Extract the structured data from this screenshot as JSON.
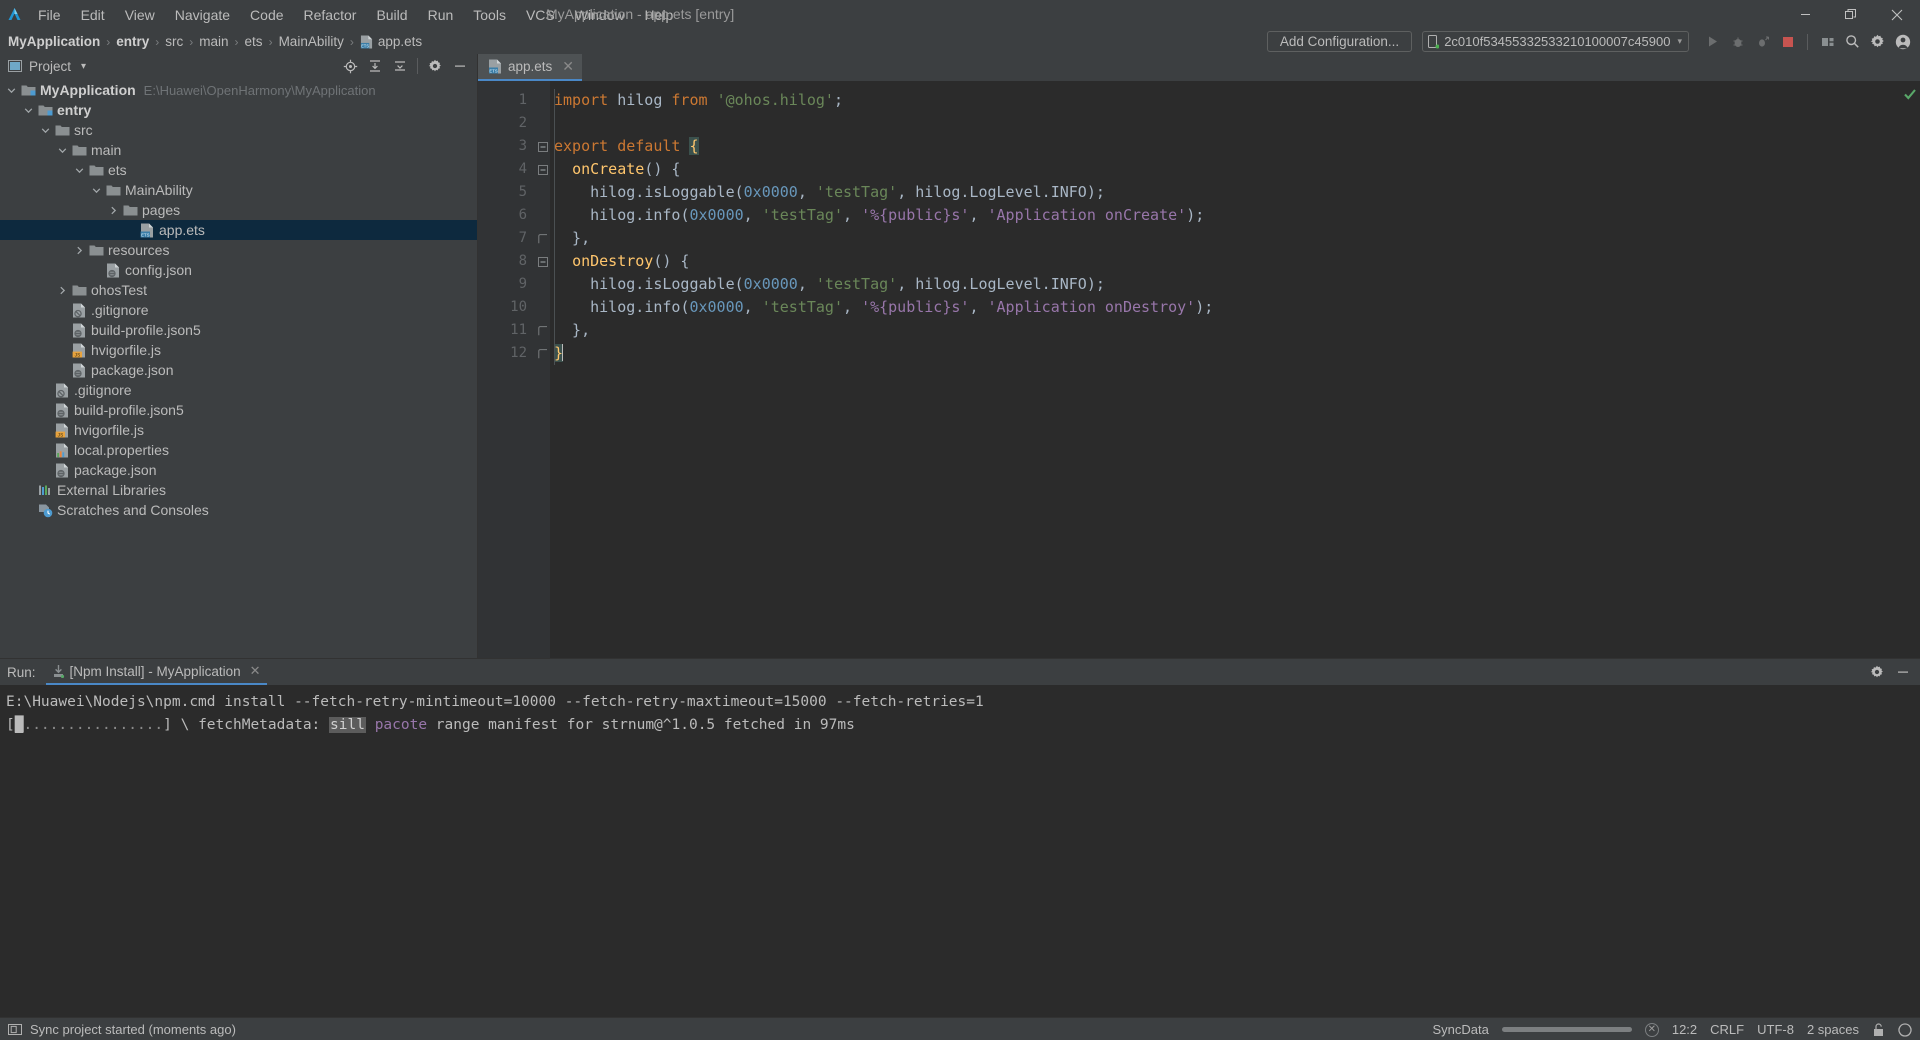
{
  "window": {
    "title": "MyApplication - app.ets [entry]",
    "minimize_label": "Minimize",
    "maximize_label": "Restore",
    "close_label": "Close"
  },
  "menubar": {
    "items": [
      {
        "label": "File"
      },
      {
        "label": "Edit"
      },
      {
        "label": "View"
      },
      {
        "label": "Navigate"
      },
      {
        "label": "Code"
      },
      {
        "label": "Refactor"
      },
      {
        "label": "Build"
      },
      {
        "label": "Run"
      },
      {
        "label": "Tools"
      },
      {
        "label": "VCS"
      },
      {
        "label": "Window"
      },
      {
        "label": "Help"
      }
    ]
  },
  "breadcrumb": {
    "items": [
      "MyApplication",
      "entry",
      "src",
      "main",
      "ets",
      "MainAbility",
      "app.ets"
    ],
    "separator": "›"
  },
  "toolbar": {
    "add_configuration_label": "Add Configuration...",
    "device_label": "2c010f53455332533210100007c45900",
    "device_caret": "▾",
    "icons": [
      {
        "name": "run-icon",
        "title": "Run"
      },
      {
        "name": "debug-icon",
        "title": "Debug"
      },
      {
        "name": "profile-icon",
        "title": "Profile"
      },
      {
        "name": "stop-icon",
        "title": "Stop"
      },
      {
        "name": "project-structure-icon",
        "title": "Project Structure"
      },
      {
        "name": "search-icon",
        "title": "Search Everywhere"
      },
      {
        "name": "settings-icon",
        "title": "Settings"
      },
      {
        "name": "account-icon",
        "title": "Account"
      }
    ]
  },
  "project_panel": {
    "title": "Project",
    "dropdown_caret": "▾",
    "header_icons": [
      {
        "name": "locate-icon",
        "title": "Select Opened File"
      },
      {
        "name": "expand-all-icon",
        "title": "Expand All"
      },
      {
        "name": "collapse-all-icon",
        "title": "Collapse All"
      },
      {
        "name": "gear-icon",
        "title": "Options"
      },
      {
        "name": "hide-icon",
        "title": "Hide"
      }
    ],
    "tree": [
      {
        "label": "MyApplication",
        "path": "E:\\Huawei\\OpenHarmony\\MyApplication",
        "indent": 0,
        "arrow": "down",
        "icon": "module-folder-icon",
        "bold": true,
        "selected": false
      },
      {
        "label": "entry",
        "path": "",
        "indent": 1,
        "arrow": "down",
        "icon": "module-folder-icon",
        "bold": true,
        "selected": false
      },
      {
        "label": "src",
        "path": "",
        "indent": 2,
        "arrow": "down",
        "icon": "folder-icon",
        "bold": false,
        "selected": false
      },
      {
        "label": "main",
        "path": "",
        "indent": 3,
        "arrow": "down",
        "icon": "folder-icon",
        "bold": false,
        "selected": false
      },
      {
        "label": "ets",
        "path": "",
        "indent": 4,
        "arrow": "down",
        "icon": "folder-icon",
        "bold": false,
        "selected": false
      },
      {
        "label": "MainAbility",
        "path": "",
        "indent": 5,
        "arrow": "down",
        "icon": "folder-icon",
        "bold": false,
        "selected": false
      },
      {
        "label": "pages",
        "path": "",
        "indent": 6,
        "arrow": "right",
        "icon": "folder-icon",
        "bold": false,
        "selected": false
      },
      {
        "label": "app.ets",
        "path": "",
        "indent": 7,
        "arrow": "none",
        "icon": "ets-file-icon",
        "bold": false,
        "selected": true
      },
      {
        "label": "resources",
        "path": "",
        "indent": 4,
        "arrow": "right",
        "icon": "folder-icon",
        "bold": false,
        "selected": false
      },
      {
        "label": "config.json",
        "path": "",
        "indent": 5,
        "arrow": "none",
        "icon": "json-file-icon",
        "bold": false,
        "selected": false
      },
      {
        "label": "ohosTest",
        "path": "",
        "indent": 3,
        "arrow": "right",
        "icon": "folder-icon",
        "bold": false,
        "selected": false
      },
      {
        "label": ".gitignore",
        "path": "",
        "indent": 3,
        "arrow": "none",
        "icon": "gitignore-file-icon",
        "bold": false,
        "selected": false
      },
      {
        "label": "build-profile.json5",
        "path": "",
        "indent": 3,
        "arrow": "none",
        "icon": "json-file-icon",
        "bold": false,
        "selected": false
      },
      {
        "label": "hvigorfile.js",
        "path": "",
        "indent": 3,
        "arrow": "none",
        "icon": "js-file-icon",
        "bold": false,
        "selected": false
      },
      {
        "label": "package.json",
        "path": "",
        "indent": 3,
        "arrow": "none",
        "icon": "json-file-icon",
        "bold": false,
        "selected": false
      },
      {
        "label": ".gitignore",
        "path": "",
        "indent": 2,
        "arrow": "none",
        "icon": "gitignore-file-icon",
        "bold": false,
        "selected": false
      },
      {
        "label": "build-profile.json5",
        "path": "",
        "indent": 2,
        "arrow": "none",
        "icon": "json-file-icon",
        "bold": false,
        "selected": false
      },
      {
        "label": "hvigorfile.js",
        "path": "",
        "indent": 2,
        "arrow": "none",
        "icon": "js-file-icon",
        "bold": false,
        "selected": false
      },
      {
        "label": "local.properties",
        "path": "",
        "indent": 2,
        "arrow": "none",
        "icon": "properties-file-icon",
        "bold": false,
        "selected": false
      },
      {
        "label": "package.json",
        "path": "",
        "indent": 2,
        "arrow": "none",
        "icon": "json-file-icon",
        "bold": false,
        "selected": false
      },
      {
        "label": "External Libraries",
        "path": "",
        "indent": 1,
        "arrow": "none",
        "icon": "libraries-icon",
        "bold": false,
        "selected": false
      },
      {
        "label": "Scratches and Consoles",
        "path": "",
        "indent": 1,
        "arrow": "none",
        "icon": "scratches-icon",
        "bold": false,
        "selected": false
      }
    ]
  },
  "editor": {
    "tab": {
      "label": "app.ets",
      "close": "✕",
      "icon": "ets-file-icon"
    },
    "inspection_status": "ok",
    "line_numbers": [
      "1",
      "2",
      "3",
      "4",
      "5",
      "6",
      "7",
      "8",
      "9",
      "10",
      "11",
      "12"
    ],
    "lines": [
      [
        {
          "t": "import ",
          "c": "kw"
        },
        {
          "t": "hilog ",
          "c": "pl"
        },
        {
          "t": "from ",
          "c": "kw"
        },
        {
          "t": "'@ohos.hilog'",
          "c": "strq"
        },
        {
          "t": ";",
          "c": "pl"
        }
      ],
      [],
      [
        {
          "t": "export default ",
          "c": "kw"
        },
        {
          "t": "{",
          "c": "brace-hl"
        }
      ],
      [
        {
          "t": "  ",
          "c": "pl"
        },
        {
          "t": "onCreate",
          "c": "fn"
        },
        {
          "t": "() {",
          "c": "pl"
        }
      ],
      [
        {
          "t": "    hilog.",
          "c": "pl"
        },
        {
          "t": "isLoggable",
          "c": "pl"
        },
        {
          "t": "(",
          "c": "pl"
        },
        {
          "t": "0x0000",
          "c": "num"
        },
        {
          "t": ", ",
          "c": "pl"
        },
        {
          "t": "'testTag'",
          "c": "strq"
        },
        {
          "t": ", hilog.LogLevel.INFO);",
          "c": "pl"
        }
      ],
      [
        {
          "t": "    hilog.",
          "c": "pl"
        },
        {
          "t": "info",
          "c": "pl"
        },
        {
          "t": "(",
          "c": "pl"
        },
        {
          "t": "0x0000",
          "c": "num"
        },
        {
          "t": ", ",
          "c": "pl"
        },
        {
          "t": "'testTag'",
          "c": "strq"
        },
        {
          "t": ", ",
          "c": "pl"
        },
        {
          "t": "'%{public}s'",
          "c": "prop"
        },
        {
          "t": ", ",
          "c": "pl"
        },
        {
          "t": "'Application onCreate'",
          "c": "prop"
        },
        {
          "t": ");",
          "c": "pl"
        }
      ],
      [
        {
          "t": "  },",
          "c": "pl"
        }
      ],
      [
        {
          "t": "  ",
          "c": "pl"
        },
        {
          "t": "onDestroy",
          "c": "fn"
        },
        {
          "t": "() {",
          "c": "pl"
        }
      ],
      [
        {
          "t": "    hilog.",
          "c": "pl"
        },
        {
          "t": "isLoggable",
          "c": "pl"
        },
        {
          "t": "(",
          "c": "pl"
        },
        {
          "t": "0x0000",
          "c": "num"
        },
        {
          "t": ", ",
          "c": "pl"
        },
        {
          "t": "'testTag'",
          "c": "strq"
        },
        {
          "t": ", hilog.LogLevel.INFO);",
          "c": "pl"
        }
      ],
      [
        {
          "t": "    hilog.",
          "c": "pl"
        },
        {
          "t": "info",
          "c": "pl"
        },
        {
          "t": "(",
          "c": "pl"
        },
        {
          "t": "0x0000",
          "c": "num"
        },
        {
          "t": ", ",
          "c": "pl"
        },
        {
          "t": "'testTag'",
          "c": "strq"
        },
        {
          "t": ", ",
          "c": "pl"
        },
        {
          "t": "'%{public}s'",
          "c": "prop"
        },
        {
          "t": ", ",
          "c": "pl"
        },
        {
          "t": "'Application onDestroy'",
          "c": "prop"
        },
        {
          "t": ");",
          "c": "pl"
        }
      ],
      [
        {
          "t": "  },",
          "c": "pl"
        }
      ],
      [
        {
          "t": "}",
          "c": "brace-hl"
        }
      ]
    ]
  },
  "run_panel": {
    "label": "Run:",
    "tab_label": "[Npm Install] - MyApplication",
    "tab_close": "✕",
    "header_icons": [
      {
        "name": "gear-icon",
        "title": "Settings"
      },
      {
        "name": "hide-icon",
        "title": "Hide"
      }
    ],
    "console_lines": [
      {
        "type": "plain",
        "text": "E:\\Huawei\\Nodejs\\npm.cmd install --fetch-retry-mintimeout=10000 --fetch-retry-maxtimeout=15000 --fetch-retries=1"
      },
      {
        "type": "progress",
        "prefix": "[",
        "bar": "█",
        "dots": "................",
        "suffix": "] \\ fetchMetadata: ",
        "badge": "sill",
        "highlight": "pacote",
        "rest": " range manifest for strnum@^1.0.5 fetched in 97ms"
      }
    ]
  },
  "statusbar": {
    "left_message": "Sync project started (moments ago)",
    "sync_label": "SyncData",
    "progress_percent": 100,
    "cancel_glyph": "✕",
    "caret_position": "12:2",
    "line_separator": "CRLF",
    "encoding": "UTF-8",
    "indent": "2 spaces",
    "lock_icon": "lock-icon",
    "eventlog_icon": "event-log-icon"
  },
  "colors": {
    "accent": "#4a88c7",
    "panel_bg": "#3c3f41",
    "editor_bg": "#2b2b2b",
    "selection": "#0d293e",
    "stop_red": "#c75450",
    "ok_green": "#59a869"
  }
}
